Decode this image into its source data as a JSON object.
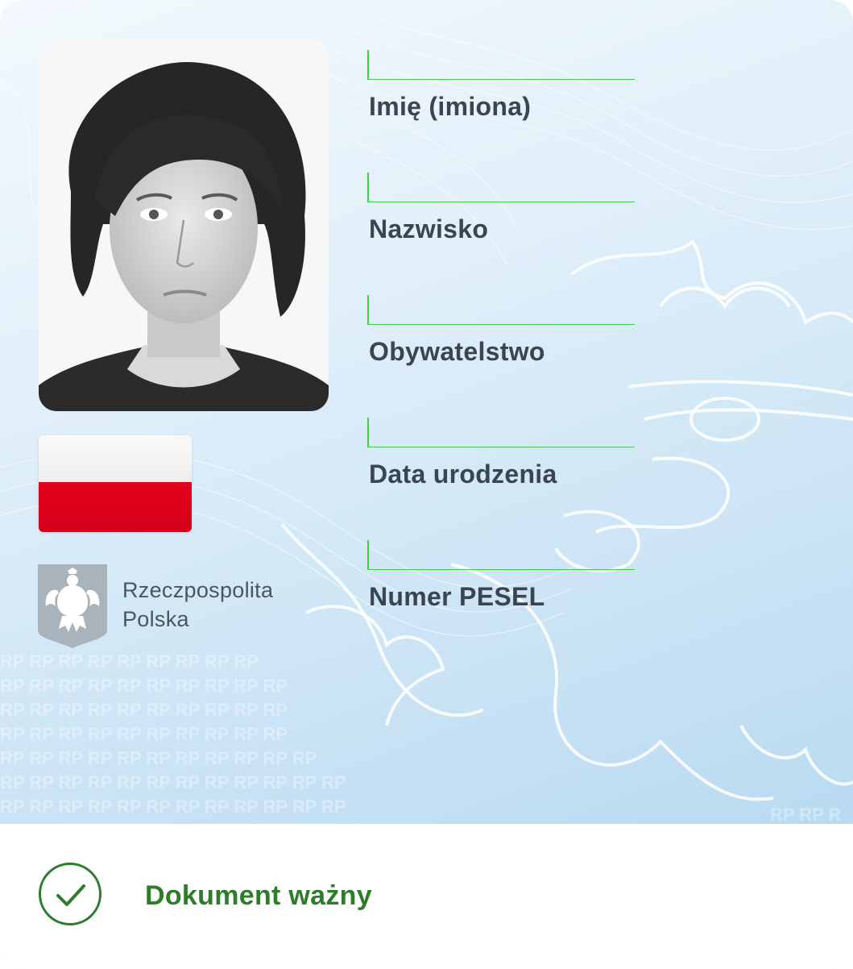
{
  "document": {
    "country_line1": "Rzeczpospolita",
    "country_line2": "Polska",
    "watermark_text": "RP"
  },
  "fields": [
    {
      "label": "Imię (imiona)",
      "value": ""
    },
    {
      "label": "Nazwisko",
      "value": ""
    },
    {
      "label": "Obywatelstwo",
      "value": ""
    },
    {
      "label": "Data urodzenia",
      "value": ""
    },
    {
      "label": "Numer PESEL",
      "value": ""
    }
  ],
  "status": {
    "text": "Dokument ważny",
    "icon": "check-circle-icon",
    "color": "#2e7d2a"
  },
  "flag": {
    "top_color": "#ffffff",
    "bottom_color": "#dc143c"
  },
  "colors": {
    "field_rule": "#3fcf44",
    "label_text": "#3b4552"
  }
}
